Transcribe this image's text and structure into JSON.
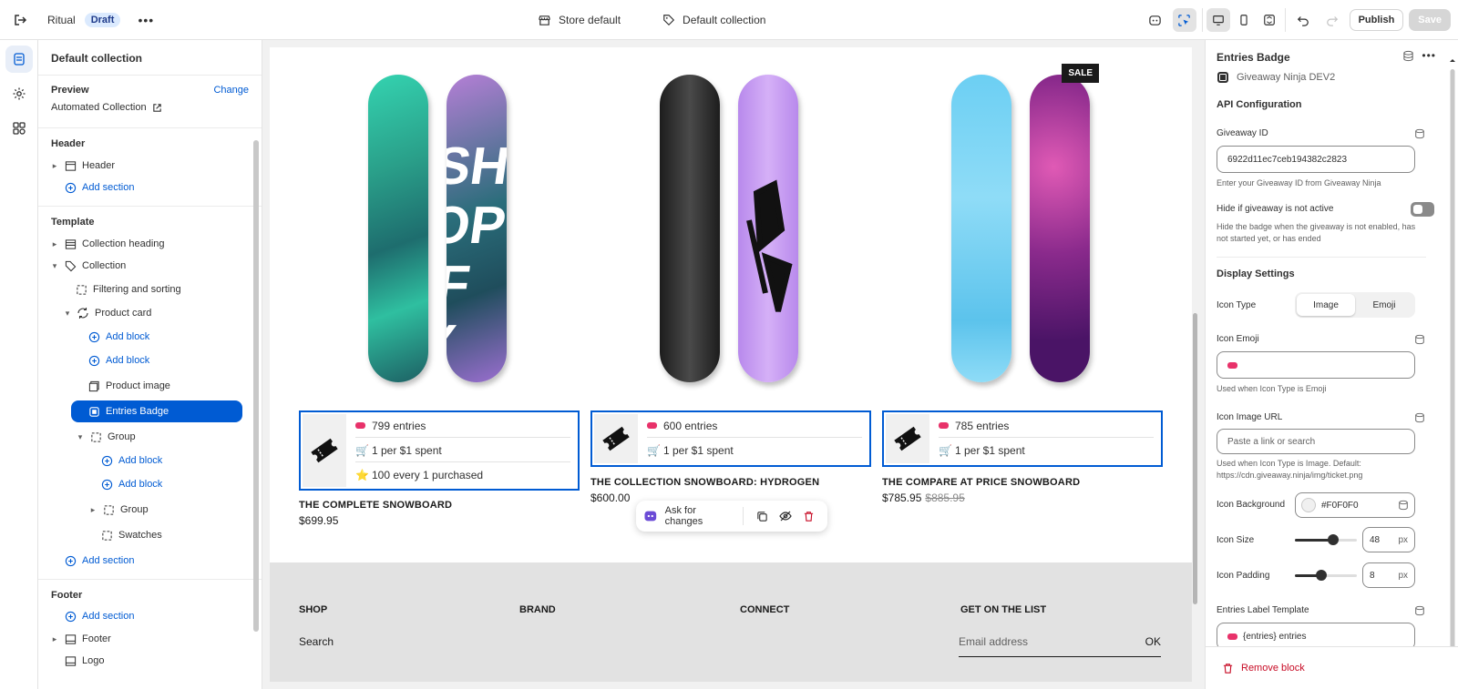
{
  "topbar": {
    "theme_name": "Ritual",
    "draft_badge": "Draft",
    "more": "•••",
    "store_context": "Store default",
    "template_context": "Default collection",
    "publish": "Publish",
    "save": "Save"
  },
  "sidebar": {
    "title": "Default collection",
    "preview_label": "Preview",
    "change_link": "Change",
    "preview_value": "Automated Collection",
    "header_group": "Header",
    "header_item": "Header",
    "add_section": "Add section",
    "template_group": "Template",
    "collection_heading": "Collection heading",
    "collection": "Collection",
    "filtering": "Filtering and sorting",
    "product_card": "Product card",
    "add_block": "Add block",
    "product_image": "Product image",
    "entries_badge": "Entries Badge",
    "group": "Group",
    "swatches": "Swatches",
    "footer_group": "Footer",
    "footer_item": "Footer",
    "logo": "Logo"
  },
  "canvas": {
    "sale_badge": "SALE",
    "products": [
      {
        "title": "THE COMPLETE SNOWBOARD",
        "price": "$699.95",
        "compare_price": "",
        "badge_lines": [
          "799 entries",
          "1 per $1 spent",
          "100 every 1 purchased"
        ],
        "emojis": [
          "pill",
          "🛒",
          "⭐"
        ]
      },
      {
        "title": "THE COLLECTION SNOWBOARD: HYDROGEN",
        "price": "$600.00",
        "compare_price": "",
        "badge_lines": [
          "600 entries",
          "1 per $1 spent"
        ],
        "emojis": [
          "pill",
          "🛒"
        ]
      },
      {
        "title": "THE COMPARE AT PRICE SNOWBOARD",
        "price": "$785.95",
        "compare_price": "$885.95",
        "badge_lines": [
          "785 entries",
          "1 per $1 spent"
        ],
        "emojis": [
          "pill",
          "🛒"
        ]
      }
    ],
    "ask_bar": {
      "label": "Ask for changes"
    },
    "footer": {
      "col1": "SHOP",
      "col2": "BRAND",
      "col3": "CONNECT",
      "col4": "GET ON THE LIST",
      "search_link": "Search",
      "email_placeholder": "Email address",
      "ok": "OK"
    }
  },
  "right_panel": {
    "title": "Entries Badge",
    "app_name": "Giveaway Ninja DEV2",
    "api_config": "API Configuration",
    "giveaway_id_label": "Giveaway ID",
    "giveaway_id_value": "6922d11ec7ceb194382c2823",
    "giveaway_id_help": "Enter your Giveaway ID from Giveaway Ninja",
    "hide_label": "Hide if giveaway is not active",
    "hide_help": "Hide the badge when the giveaway is not enabled, has not started yet, or has ended",
    "hide_value": false,
    "display_settings": "Display Settings",
    "icon_type_label": "Icon Type",
    "icon_type_options": [
      "Image",
      "Emoji"
    ],
    "icon_type_selected": "Image",
    "icon_emoji_label": "Icon Emoji",
    "icon_emoji_help": "Used when Icon Type is Emoji",
    "icon_image_url_label": "Icon Image URL",
    "icon_image_url_placeholder": "Paste a link or search",
    "icon_image_url_help": "Used when Icon Type is Image. Default: https://cdn.giveaway.ninja/img/ticket.png",
    "icon_bg_label": "Icon Background",
    "icon_bg_value": "#F0F0F0",
    "icon_size_label": "Icon Size",
    "icon_size_value": "48",
    "icon_size_unit": "px",
    "icon_size_fraction": 0.62,
    "icon_padding_label": "Icon Padding",
    "icon_padding_value": "8",
    "icon_padding_unit": "px",
    "icon_padding_fraction": 0.42,
    "entries_label_template_label": "Entries Label Template",
    "entries_label_template_value": "{entries} entries",
    "remove_block": "Remove block"
  },
  "colors": {
    "accent": "#005bd3",
    "danger": "#c70a24",
    "entries_pill": "#e8326a"
  }
}
